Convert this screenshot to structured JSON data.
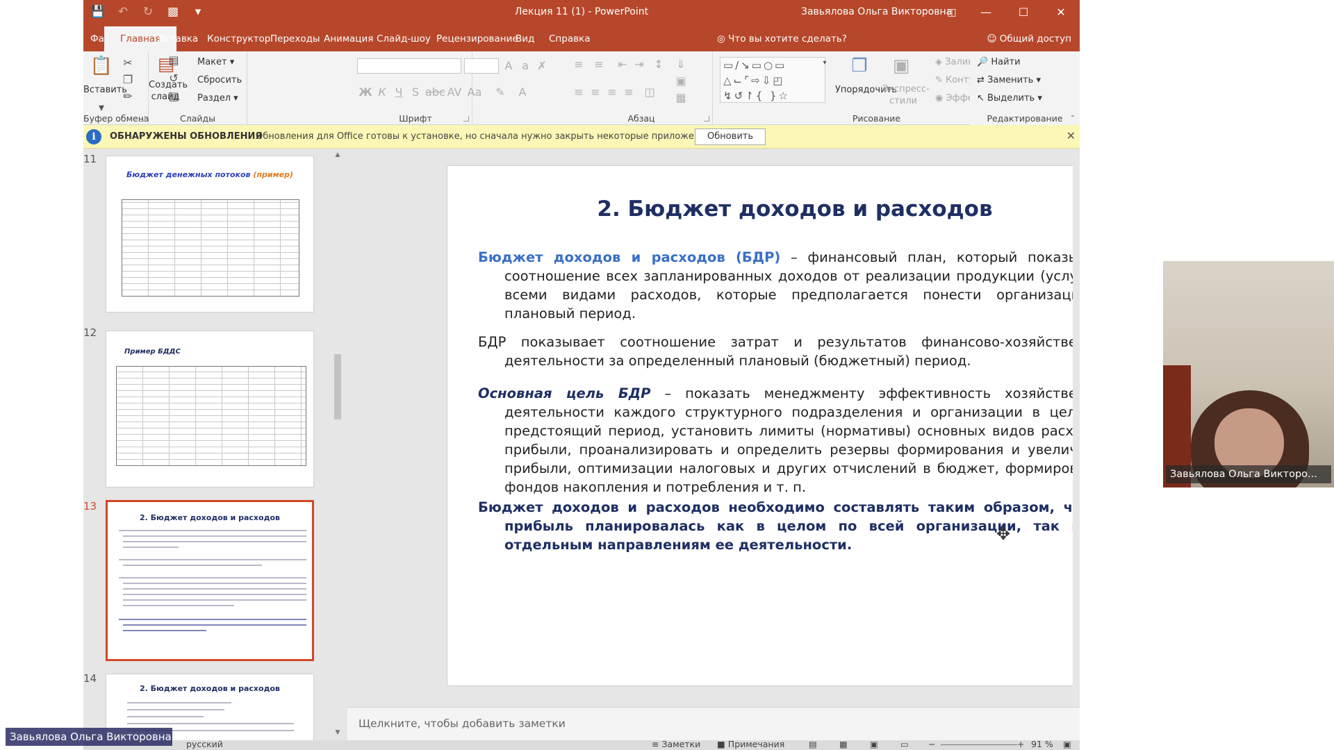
{
  "window": {
    "doc_title": "Лекция 11 (1) - PowerPoint",
    "user": "Завьялова Ольга Викторовна"
  },
  "tabs": [
    "Файл",
    "Главная",
    "Вставка",
    "Конструктор",
    "Переходы",
    "Анимация",
    "Слайд-шоу",
    "Рецензирование",
    "Вид",
    "Справка"
  ],
  "tell_me": "Что вы хотите сделать?",
  "share": "Общий доступ",
  "ribbon": {
    "clipboard": {
      "label": "Буфер обмена",
      "paste": "Вставить"
    },
    "slides": {
      "label": "Слайды",
      "new_slide": "Создать слайд",
      "layout": "Макет",
      "reset": "Сбросить",
      "section": "Раздел"
    },
    "font": {
      "label": "Шрифт"
    },
    "paragraph": {
      "label": "Абзац"
    },
    "drawing": {
      "label": "Рисование",
      "arrange": "Упорядочить",
      "quick_styles": "Экспресс-стили",
      "fill": "Заливка фигуры",
      "outline": "Контур фигуры",
      "effects": "Эффекты фигуры"
    },
    "editing": {
      "label": "Редактирование",
      "find": "Найти",
      "replace": "Заменить",
      "select": "Выделить"
    }
  },
  "message_bar": {
    "title": "ОБНАРУЖЕНЫ ОБНОВЛЕНИЯ",
    "text": "Обновления для Office готовы к установке, но сначала нужно закрыть некоторые приложения.",
    "button": "Обновить"
  },
  "thumbnails": [
    {
      "number": "11",
      "title": "Бюджет денежных потоков",
      "title_suffix": "(пример)"
    },
    {
      "number": "12",
      "title": "Пример БДДС"
    },
    {
      "number": "13",
      "title": "2. Бюджет доходов и расходов"
    },
    {
      "number": "14",
      "title": "2. Бюджет доходов и расходов"
    }
  ],
  "slide": {
    "title": "2. Бюджет доходов и расходов",
    "p1_term": "Бюджет доходов и расходов (БДР)",
    "p1_text": " – финансовый план, который показывает соотношение всех запланированных доходов от реализации продукции (услуг) со всеми видами расходов, которые предполагается понести организации в плановый период.",
    "p2_text": "БДР показывает соотношение затрат и результатов финансово-хозяйственной деятельности за определенный плановый (бюджетный) период.",
    "p3_term": "Основная цель БДР",
    "p3_text": " – показать менеджменту эффективность хозяйственной деятельности каждого структурного подразделения и организации в целом в предстоящий период, установить лимиты (нормативы) основных видов расходов, прибыли, проанализировать и определить резервы формирования и увеличения прибыли, оптимизации налоговых и других отчислений в бюджет, формирования фондов накопления и потребления и т. п.",
    "p4_text": "Бюджет доходов и расходов  необходимо составлять таким образом, чтобы прибыль планировалась как в целом по всей организации, так и по отдельным направлениям ее деятельности."
  },
  "notes_placeholder": "Щелкните, чтобы добавить заметки",
  "status": {
    "language": "русский",
    "notes": "Заметки",
    "comments": "Примечания",
    "zoom": "91 %"
  },
  "webcam_name": "Завьялова Ольга Викторо...",
  "presenter_label": "Завьялова Ольга Викторовна"
}
